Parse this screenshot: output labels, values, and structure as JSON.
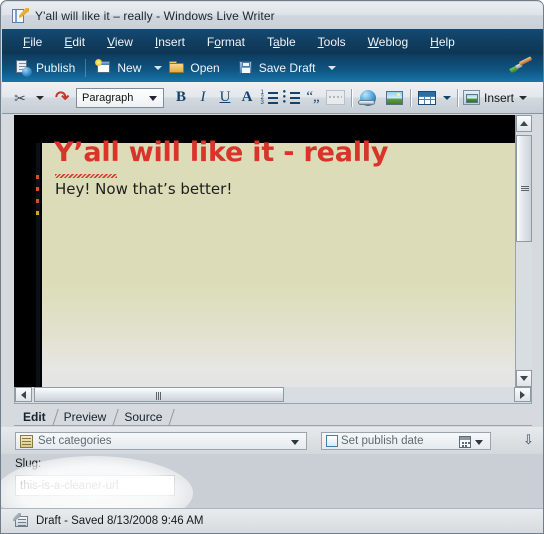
{
  "window": {
    "title": "Y'all will like it – really - Windows Live Writer",
    "icon": "writer-document-icon"
  },
  "menubar": {
    "items": [
      {
        "label": "File",
        "accel": "F"
      },
      {
        "label": "Edit",
        "accel": "E"
      },
      {
        "label": "View",
        "accel": "V"
      },
      {
        "label": "Insert",
        "accel": "I"
      },
      {
        "label": "Format",
        "accel": "o"
      },
      {
        "label": "Table",
        "accel": "a"
      },
      {
        "label": "Tools",
        "accel": "T"
      },
      {
        "label": "Weblog",
        "accel": "W"
      },
      {
        "label": "Help",
        "accel": "H"
      }
    ]
  },
  "publish_toolbar": {
    "publish_label": "Publish",
    "new_label": "New",
    "open_label": "Open",
    "save_draft_label": "Save Draft",
    "brush_icon": "paintbrush-icon"
  },
  "format_toolbar": {
    "cut_icon": "scissors-icon",
    "undo_icon": "undo-arrow-icon",
    "paragraph_style": "Paragraph",
    "bold": "B",
    "italic": "I",
    "underline": "U",
    "font_color": "A",
    "numbered_list_icon": "numbered-list-icon",
    "bulleted_list_icon": "bulleted-list-icon",
    "blockquote": "“„",
    "hr_icon": "horizontal-rule-icon",
    "hyperlink_icon": "hyperlink-globe-icon",
    "picture_icon": "insert-picture-icon",
    "table_icon": "insert-table-icon",
    "insert_label": "Insert"
  },
  "document": {
    "title": "Y’all will like it - really",
    "body": "Hey! Now that’s better!",
    "title_color": "#d8342a",
    "page_background": "#dcddb8"
  },
  "tabs": [
    {
      "label": "Edit",
      "active": true
    },
    {
      "label": "Preview",
      "active": false
    },
    {
      "label": "Source",
      "active": false
    }
  ],
  "properties": {
    "categories_label": "Set categories",
    "publish_date_label": "Set publish date",
    "expand_icon": "chevron-double-down-icon"
  },
  "slug": {
    "label": "Slug:",
    "value": "this-is-a-cleaner-url"
  },
  "status": {
    "text": "Draft - Saved 8/13/2008 9:46 AM",
    "icon": "draft-pen-icon"
  },
  "scrollbars": {
    "up_arrow": "scroll-up-arrow",
    "down_arrow": "scroll-down-arrow",
    "left_arrow": "scroll-left-arrow",
    "right_arrow": "scroll-right-arrow"
  }
}
